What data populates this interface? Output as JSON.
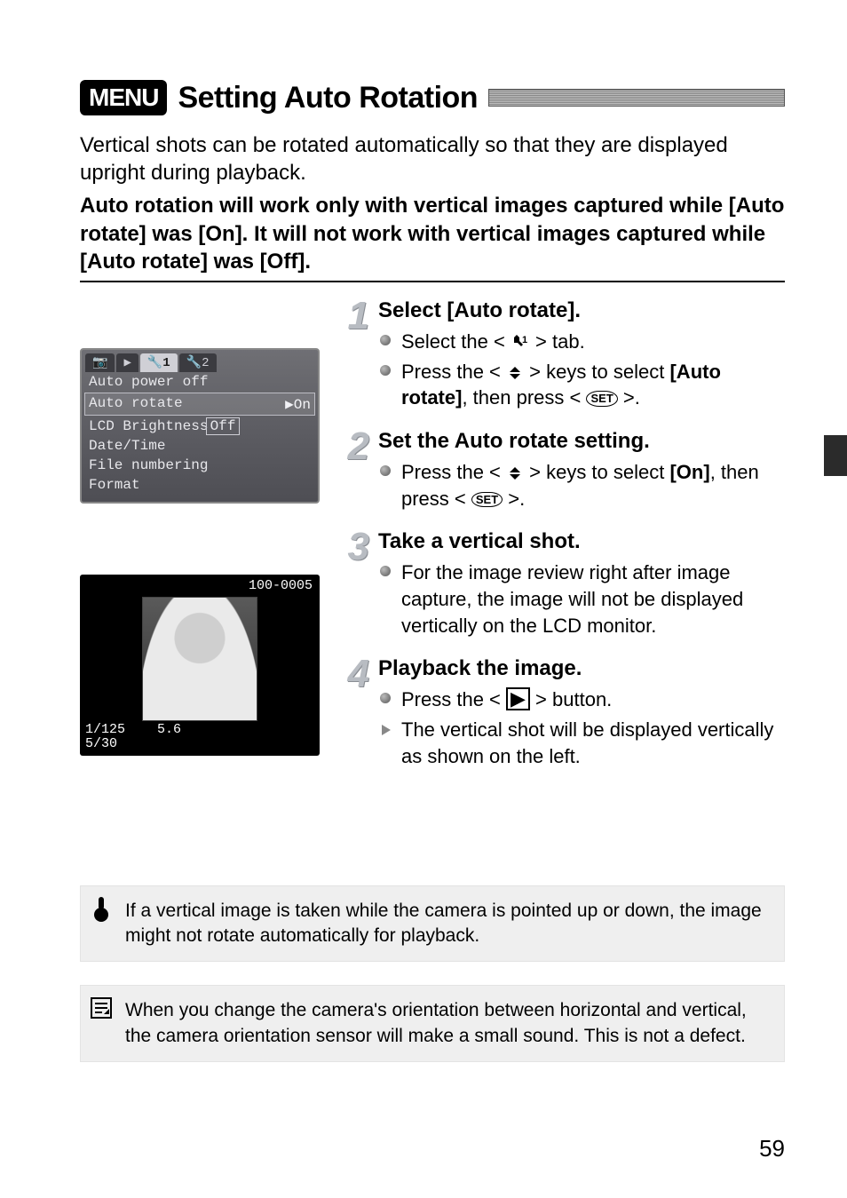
{
  "title": {
    "menu_badge": "MENU",
    "heading": "Setting Auto Rotation"
  },
  "intro": {
    "p1": "Vertical shots can be rotated automatically so that they are displayed upright during playback.",
    "p2": "Auto rotation will work only with vertical images captured while [Auto rotate] was [On]. It will not work with vertical images captured while [Auto rotate] was [Off]."
  },
  "camera_menu": {
    "tabs": [
      "📷",
      "▶",
      "🔧1",
      "🔧2"
    ],
    "items": {
      "auto_power_off": "Auto power off",
      "auto_rotate": "Auto rotate",
      "auto_rotate_on": "▶On",
      "lcd_brightness": "LCD Brightness",
      "lcd_brightness_off": "Off",
      "date_time": "Date/Time",
      "file_numbering": "File numbering",
      "format": "Format"
    }
  },
  "playback": {
    "folder_file": "100-0005",
    "shutter": "1/125",
    "aperture": "5.6",
    "index": "5/30"
  },
  "steps": [
    {
      "num": "1",
      "heading": "Select [Auto rotate].",
      "bullets": [
        {
          "pre": "Select the < ",
          "icon": "wrench1",
          "post": " > tab."
        },
        {
          "pre": "Press the < ",
          "icon": "updown",
          "post": " > keys to select ",
          "bold1": "[Auto rotate]",
          "post2": ", then press < ",
          "icon2": "set",
          "post3": " >."
        }
      ]
    },
    {
      "num": "2",
      "heading": "Set the Auto rotate setting.",
      "bullets": [
        {
          "pre": "Press the < ",
          "icon": "updown",
          "post": " > keys to select ",
          "bold1": "[On]",
          "post2": ", then press < ",
          "icon2": "set",
          "post3": " >."
        }
      ]
    },
    {
      "num": "3",
      "heading": "Take a vertical shot.",
      "bullets": [
        {
          "text": "For the image review right after image capture, the image will not be displayed vertically on the LCD monitor."
        }
      ]
    },
    {
      "num": "4",
      "heading": "Playback the image.",
      "bullets": [
        {
          "pre": "Press the < ",
          "icon": "play",
          "post": " > button."
        },
        {
          "arrow": true,
          "text": "The vertical shot will be displayed vertically as shown on the left."
        }
      ]
    }
  ],
  "notes": {
    "warn": "If a vertical image is taken while the camera is pointed up or down, the image might not rotate automatically for playback.",
    "info": "When you change the camera's orientation between horizontal and vertical, the camera orientation sensor will make a small sound. This is not a defect."
  },
  "page_number": "59"
}
